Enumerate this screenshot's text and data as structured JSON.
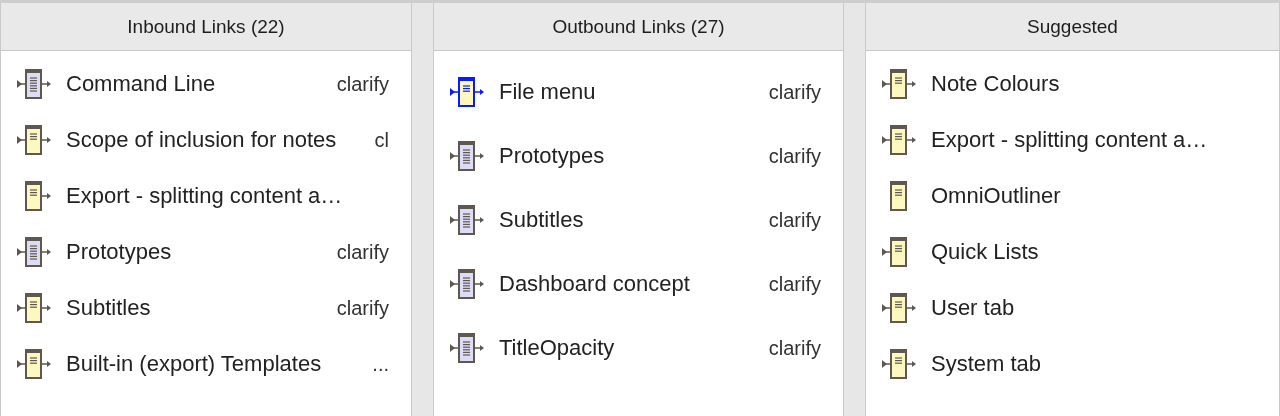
{
  "panels": [
    {
      "title": "Inbound Links (22)",
      "rows": [
        {
          "name": "Command Line",
          "tag": "clarify",
          "color": "#dcdcf5",
          "inbound": true,
          "outbound": true,
          "selected": false
        },
        {
          "name": "Scope of inclusion for notes",
          "tag": "cl",
          "color": "#fdf8c0",
          "inbound": true,
          "outbound": true,
          "selected": false
        },
        {
          "name": "Export - splitting content a…",
          "color": "#fdf8c0",
          "inbound": false,
          "outbound": true,
          "selected": false
        },
        {
          "name": "Prototypes",
          "tag": "clarify",
          "color": "#dcdcf5",
          "inbound": true,
          "outbound": true,
          "selected": false
        },
        {
          "name": "Subtitles",
          "tag": "clarify",
          "color": "#fdf8c0",
          "inbound": true,
          "outbound": true,
          "selected": false
        },
        {
          "name": "Built-in (export) Templates",
          "tag": "...",
          "color": "#fdf8c0",
          "inbound": true,
          "outbound": true,
          "selected": false
        }
      ]
    },
    {
      "title": "Outbound Links (27)",
      "rows": [
        {
          "name": "File menu",
          "tag": "clarify",
          "color": "#fdf8c0",
          "inbound": true,
          "outbound": true,
          "selected": true
        },
        {
          "name": "Prototypes",
          "tag": "clarify",
          "color": "#dcdcf5",
          "inbound": true,
          "outbound": true,
          "selected": false
        },
        {
          "name": "Subtitles",
          "tag": "clarify",
          "color": "#dcdcf5",
          "inbound": true,
          "outbound": true,
          "selected": false
        },
        {
          "name": "Dashboard concept",
          "tag": "clarify",
          "color": "#dcdcf5",
          "inbound": true,
          "outbound": true,
          "selected": false
        },
        {
          "name": "TitleOpacity",
          "tag": "clarify",
          "color": "#dcdcf5",
          "inbound": true,
          "outbound": true,
          "selected": false
        }
      ]
    },
    {
      "title": "Suggested",
      "rows": [
        {
          "name": "Note Colours",
          "color": "#fdf8c0",
          "inbound": true,
          "outbound": true,
          "selected": false
        },
        {
          "name": "Export - splitting content a…",
          "color": "#fdf8c0",
          "inbound": true,
          "outbound": true,
          "selected": false
        },
        {
          "name": "OmniOutliner",
          "color": "#fdf8c0",
          "inbound": false,
          "outbound": false,
          "selected": false
        },
        {
          "name": "Quick Lists",
          "color": "#fdf8c0",
          "inbound": true,
          "outbound": false,
          "selected": false
        },
        {
          "name": "User tab",
          "color": "#fdf8c0",
          "inbound": true,
          "outbound": true,
          "selected": false
        },
        {
          "name": "System tab",
          "color": "#fdf8c0",
          "inbound": true,
          "outbound": true,
          "selected": false
        }
      ]
    }
  ]
}
